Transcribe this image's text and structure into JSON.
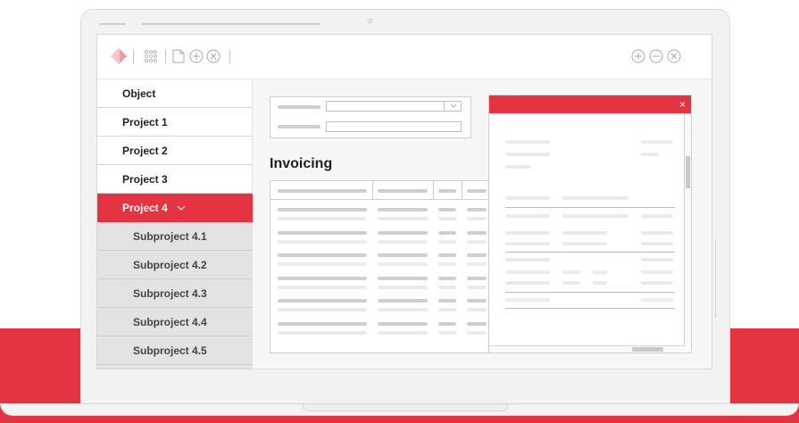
{
  "colors": {
    "accent": "#e53441",
    "nav_border": "#d5d5d5",
    "sub_bg": "#e3e3e3"
  },
  "toolbar": {
    "icons": [
      "logo-diamond-icon",
      "grid-icon",
      "document-icon",
      "add-circle-icon",
      "close-circle-icon",
      "window-add-icon",
      "window-minimize-icon",
      "window-close-icon"
    ]
  },
  "sidebar": {
    "header": "Object",
    "items": [
      {
        "label": "Project 1"
      },
      {
        "label": "Project 2"
      },
      {
        "label": "Project 3"
      },
      {
        "label": "Project 4",
        "expanded": true,
        "active": true
      }
    ],
    "subitems": [
      {
        "label": "Subproject 4.1"
      },
      {
        "label": "Subproject 4.2"
      },
      {
        "label": "Subproject 4.3"
      },
      {
        "label": "Subproject 4.4"
      },
      {
        "label": "Subproject 4.5"
      }
    ]
  },
  "main": {
    "title": "Invoicing"
  },
  "popup": {
    "close_symbol": "×"
  }
}
